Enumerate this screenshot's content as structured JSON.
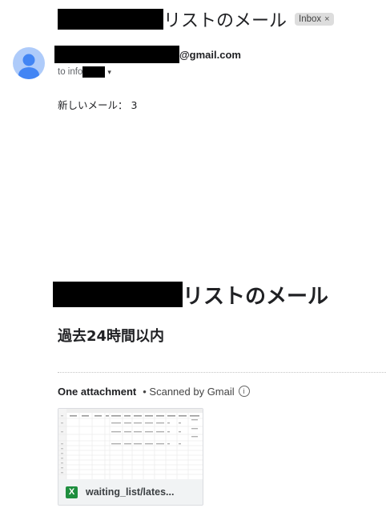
{
  "header": {
    "subject_suffix": "リストのメール",
    "inbox_label": "Inbox",
    "inbox_close": "×"
  },
  "sender": {
    "email_suffix": "@gmail.com",
    "to_prefix": "to info",
    "to_caret": "▾",
    "avatar_color": "#aecbfa"
  },
  "message": {
    "body_line": "新しいメール： 3",
    "big_title_suffix": "リストのメール",
    "sub_heading": "過去24時間以内"
  },
  "attachments": {
    "title": "One attachment",
    "scanned": "• Scanned by Gmail",
    "info_icon": "ⓘ",
    "file": {
      "icon_letter": "X",
      "icon_name": "excel-icon",
      "icon_color": "#1e8e3e",
      "name": "waiting_list/lates..."
    },
    "preview": {
      "columns": [
        "A",
        "B",
        "C",
        "D",
        "E",
        "F",
        "G",
        "H",
        "I",
        "J"
      ],
      "headers": [
        "ID",
        "Name",
        "Email",
        "Time",
        "DateTime",
        "Memo",
        "Link",
        "Time Added",
        "Date",
        "Time"
      ]
    }
  }
}
